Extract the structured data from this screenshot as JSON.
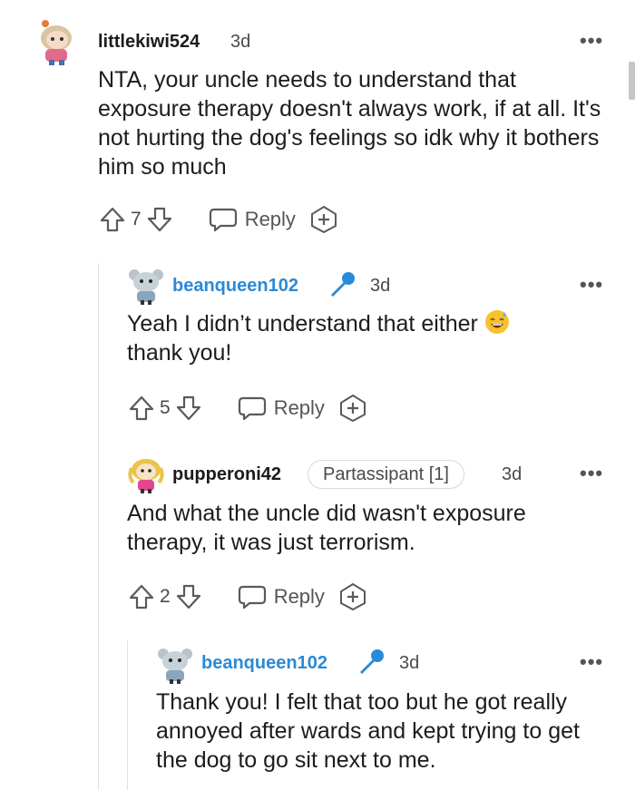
{
  "comments": [
    {
      "username": "littlekiwi524",
      "time": "3d",
      "text": "NTA, your uncle needs to understand that exposure therapy doesn't always work, if at all. It's not hurting the dog's feelings so idk why it bothers him so much",
      "votes": "7",
      "reply_label": "Reply"
    },
    {
      "username": "beanqueen102",
      "time": "3d",
      "text": "Yeah I didn’t understand that either",
      "text_line2": "thank you!",
      "votes": "5",
      "reply_label": "Reply",
      "emoji": "grinning-sweat-emoji"
    },
    {
      "username": "pupperoni42",
      "flair": "Partassipant [1]",
      "time": "3d",
      "text": "And what the uncle did wasn't exposure therapy, it was just terrorism.",
      "votes": "2",
      "reply_label": "Reply"
    },
    {
      "username": "beanqueen102",
      "time": "3d",
      "text": "Thank you! I felt that too but he got really annoyed after wards and kept trying to get the dog to go sit next to me."
    }
  ],
  "more_label": "•••",
  "colors": {
    "op_username": "#2b8ad6",
    "thread_line": "#e3e3e3",
    "icon_gray": "#5a5a5a"
  }
}
